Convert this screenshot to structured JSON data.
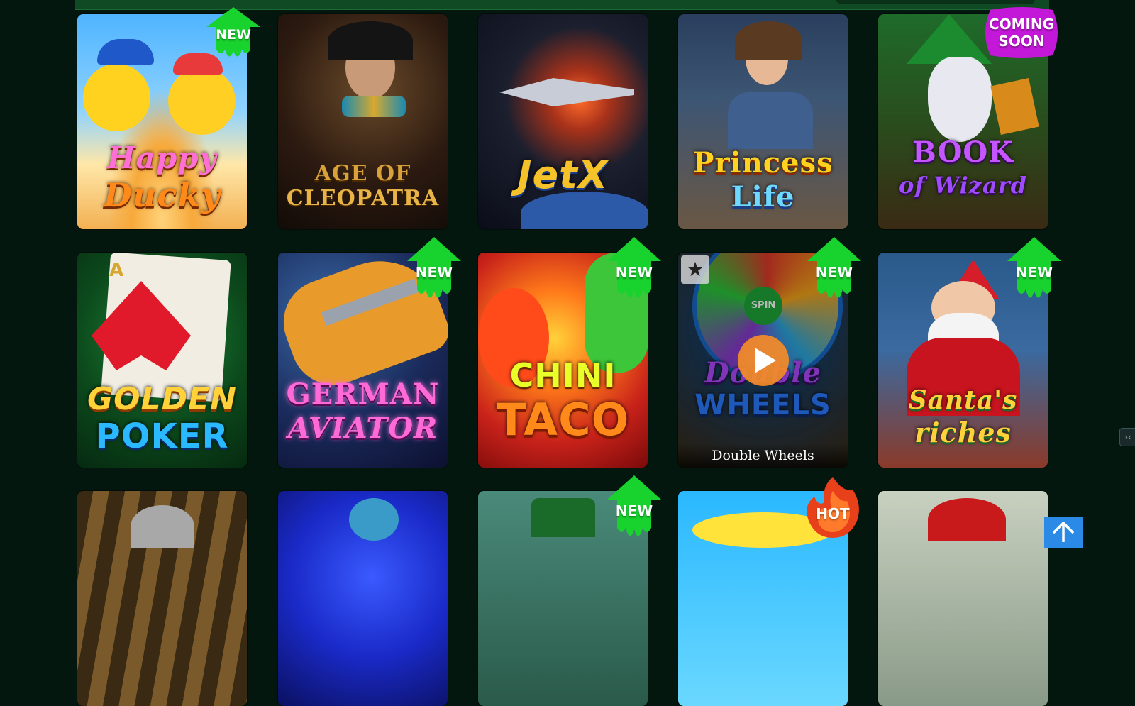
{
  "badges": {
    "new": "NEW",
    "coming_soon_1": "COMING",
    "coming_soon_2": "SOON",
    "hot": "HOT"
  },
  "games": [
    {
      "name": "Happy Ducky",
      "line1": "Happy",
      "line2": "Ducky",
      "badge": "new"
    },
    {
      "name": "Age of Cleopatra",
      "line1": "AGE OF",
      "line2": "CLEOPATRA",
      "badge": ""
    },
    {
      "name": "JetX",
      "line1": "JetX",
      "line2": "",
      "badge": ""
    },
    {
      "name": "Princess Life",
      "line1": "Princess",
      "line2": "Life",
      "badge": ""
    },
    {
      "name": "Book of Wizard",
      "line1": "BOOK",
      "line2": "of Wizard",
      "badge": "coming-soon"
    },
    {
      "name": "Golden Poker",
      "line1": "GOLDEN",
      "line2": "POKER",
      "badge": ""
    },
    {
      "name": "German Aviator",
      "line1": "GERMAN",
      "line2": "AVIATOR",
      "badge": "new"
    },
    {
      "name": "Chini Taco",
      "line1": "CHINI",
      "line2": "TACO",
      "badge": "new"
    },
    {
      "name": "Double Wheels",
      "line1": "Double",
      "line2": "WHEELS",
      "badge": "new",
      "hovered": true,
      "caption": "Double Wheels",
      "spin_label": "SPIN"
    },
    {
      "name": "Santa's Riches",
      "line1": "Santa's",
      "line2": "riches",
      "badge": "new"
    },
    {
      "name": "",
      "badge": ""
    },
    {
      "name": "",
      "badge": ""
    },
    {
      "name": "",
      "badge": "new"
    },
    {
      "name": "",
      "badge": "hot"
    },
    {
      "name": "",
      "badge": ""
    }
  ],
  "icons": {
    "favorite": "star-icon",
    "play": "play-icon",
    "scroll_top": "arrow-up-icon"
  },
  "colors": {
    "background": "#03170e",
    "new_badge": "#18d22e",
    "coming_soon_badge": "#c318d8",
    "hot_badge": "#e8401a",
    "play_button": "#f58c28",
    "scroll_button": "#2a8ae6"
  }
}
